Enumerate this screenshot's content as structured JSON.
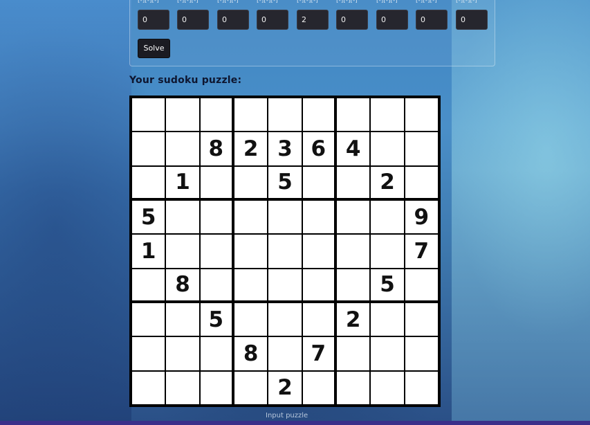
{
  "form": {
    "cell_labels": [
      "[-][-][-]",
      "[-][-][-]",
      "[-][-][-]",
      "[-][-][-]",
      "[-][-][-]",
      "[-][-][-]",
      "[-][-][-]",
      "[-][-][-]",
      "[-][-][-]"
    ],
    "last_row_values": [
      "0",
      "0",
      "0",
      "0",
      "2",
      "0",
      "0",
      "0",
      "0"
    ],
    "solve_label": "Solve"
  },
  "heading": "Your sudoku puzzle:",
  "puzzle": [
    [
      "",
      "",
      "",
      "",
      "",
      "",
      "",
      "",
      ""
    ],
    [
      "",
      "",
      "8",
      "2",
      "3",
      "6",
      "4",
      "",
      ""
    ],
    [
      "",
      "1",
      "",
      "",
      "5",
      "",
      "",
      "2",
      ""
    ],
    [
      "5",
      "",
      "",
      "",
      "",
      "",
      "",
      "",
      "9"
    ],
    [
      "1",
      "",
      "",
      "",
      "",
      "",
      "",
      "",
      "7"
    ],
    [
      "",
      "8",
      "",
      "",
      "",
      "",
      "",
      "5",
      ""
    ],
    [
      "",
      "",
      "5",
      "",
      "",
      "",
      "2",
      "",
      ""
    ],
    [
      "",
      "",
      "",
      "8",
      "",
      "7",
      "",
      "",
      ""
    ],
    [
      "",
      "",
      "",
      "",
      "2",
      "",
      "",
      "",
      ""
    ]
  ],
  "footer": {
    "input_puzzle_label": "Input puzzle"
  },
  "colors": {
    "input_bg": "#26262e",
    "button_bg": "#1b1b22",
    "grid_line": "#000000"
  }
}
